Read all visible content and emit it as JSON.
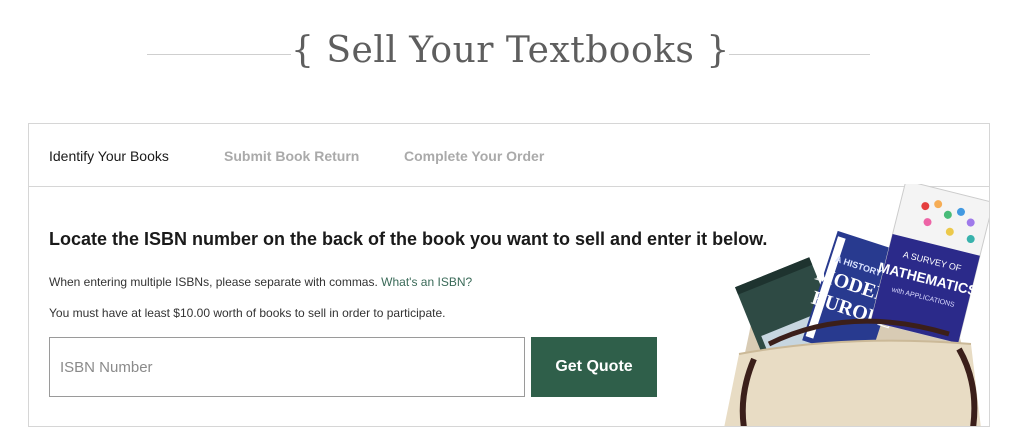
{
  "header": {
    "title": "{ Sell Your Textbooks }"
  },
  "tabs": [
    {
      "label": "Identify Your Books",
      "active": true
    },
    {
      "label": "Submit Book Return",
      "active": false
    },
    {
      "label": "Complete Your Order",
      "active": false
    }
  ],
  "main": {
    "headline": "Locate the ISBN number on the back of the book you want to sell and enter it below.",
    "note_multiple": "When entering multiple ISBNs, please separate with commas.",
    "isbn_link": "What's an ISBN?",
    "note_minimum": "You must have at least $10.00 worth of books to sell in order to participate.",
    "isbn_placeholder": "ISBN Number",
    "isbn_value": "",
    "quote_button": "Get Quote"
  },
  "illustration": {
    "icon": "tote-bag-with-textbooks",
    "book_front_title": "A SURVEY OF MATHEMATICS",
    "book_front_subtitle": "with APPLICATIONS",
    "book_middle_title": "A HISTORY OF MODERN EUROPE"
  },
  "colors": {
    "accent": "#2f5f4a",
    "link": "#3a6a58",
    "inactive_tab": "#aaaaaa",
    "title": "#5e5e5e"
  }
}
